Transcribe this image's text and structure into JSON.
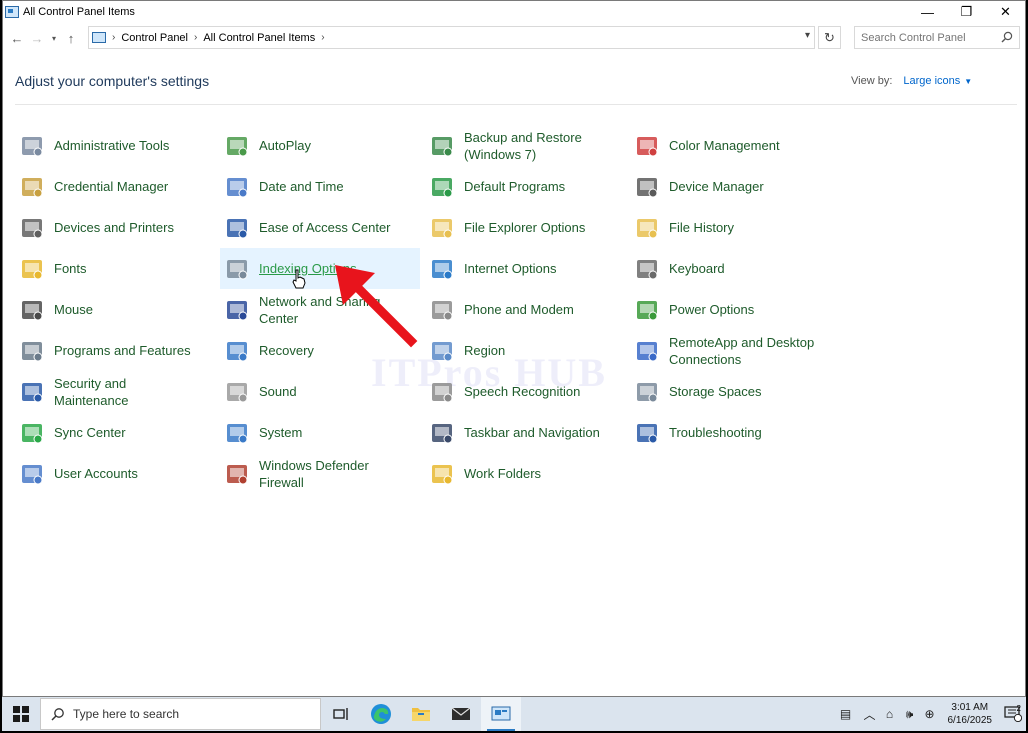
{
  "window": {
    "title": "All Control Panel Items",
    "minimize": "—",
    "restore": "❐",
    "close": "✕"
  },
  "address": {
    "crumbs": [
      "Control Panel",
      "All Control Panel Items"
    ],
    "search_placeholder": "Search Control Panel"
  },
  "content": {
    "heading": "Adjust your computer's settings",
    "view_by_label": "View by:",
    "view_by_value": "Large icons",
    "watermark": "ITPros HUB"
  },
  "items": [
    [
      "Administrative Tools",
      "AutoPlay",
      "Backup and Restore (Windows 7)",
      "Color Management"
    ],
    [
      "Credential Manager",
      "Date and Time",
      "Default Programs",
      "Device Manager"
    ],
    [
      "Devices and Printers",
      "Ease of Access Center",
      "File Explorer Options",
      "File History"
    ],
    [
      "Fonts",
      "Indexing Options",
      "Internet Options",
      "Keyboard"
    ],
    [
      "Mouse",
      "Network and Sharing Center",
      "Phone and Modem",
      "Power Options"
    ],
    [
      "Programs and Features",
      "Recovery",
      "Region",
      "RemoteApp and Desktop Connections"
    ],
    [
      "Security and Maintenance",
      "Sound",
      "Speech Recognition",
      "Storage Spaces"
    ],
    [
      "Sync Center",
      "System",
      "Taskbar and Navigation",
      "Troubleshooting"
    ],
    [
      "User Accounts",
      "Windows Defender Firewall",
      "Work Folders",
      ""
    ]
  ],
  "taskbar": {
    "search_placeholder": "Type here to search",
    "time": "3:01 AM",
    "date": "6/16/2025",
    "notification_count": "2"
  }
}
